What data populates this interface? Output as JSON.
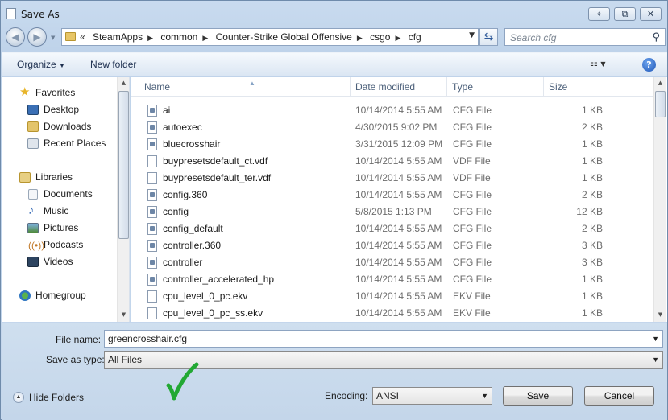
{
  "window": {
    "title": "Save As",
    "buttons": {
      "help": "⌖",
      "restore": "⧉",
      "close": "✕"
    }
  },
  "nav": {
    "back_icon": "back-arrow-icon",
    "forward_icon": "forward-arrow-icon",
    "breadcrumb_prefix": "«",
    "crumbs": [
      "SteamApps",
      "common",
      "Counter-Strike Global Offensive",
      "csgo",
      "cfg"
    ],
    "search_placeholder": "Search cfg"
  },
  "commandbar": {
    "organize": "Organize",
    "new_folder": "New folder",
    "help": "?"
  },
  "sidebar": {
    "items": [
      {
        "label": "Favorites",
        "icon": "star-icon",
        "color": "#e8b52a"
      },
      {
        "label": "Desktop",
        "icon": "desktop-icon",
        "color": "#3a6fb5"
      },
      {
        "label": "Downloads",
        "icon": "downloads-icon",
        "color": "#3b78c9"
      },
      {
        "label": "Recent Places",
        "icon": "recent-places-icon",
        "color": "#8a9aac"
      },
      {
        "label": "Libraries",
        "icon": "libraries-icon",
        "color": "#d9b75a"
      },
      {
        "label": "Documents",
        "icon": "documents-icon",
        "color": "#9aa8b8"
      },
      {
        "label": "Music",
        "icon": "music-icon",
        "color": "#3d6fb8"
      },
      {
        "label": "Pictures",
        "icon": "pictures-icon",
        "color": "#5a8fc6"
      },
      {
        "label": "Podcasts",
        "icon": "podcasts-icon",
        "color": "#c27a2a"
      },
      {
        "label": "Videos",
        "icon": "videos-icon",
        "color": "#2d4460"
      },
      {
        "label": "Homegroup",
        "icon": "homegroup-icon",
        "color": "#3c8d4a"
      }
    ]
  },
  "columns": {
    "name": "Name",
    "date": "Date modified",
    "type": "Type",
    "size": "Size"
  },
  "files": [
    {
      "name": "ai",
      "date": "10/14/2014 5:55 AM",
      "type": "CFG File",
      "size": "1 KB",
      "icon": "cfg"
    },
    {
      "name": "autoexec",
      "date": "4/30/2015 9:02 PM",
      "type": "CFG File",
      "size": "2 KB",
      "icon": "cfg"
    },
    {
      "name": "bluecrosshair",
      "date": "3/31/2015 12:09 PM",
      "type": "CFG File",
      "size": "1 KB",
      "icon": "cfg"
    },
    {
      "name": "buypresetsdefault_ct.vdf",
      "date": "10/14/2014 5:55 AM",
      "type": "VDF File",
      "size": "1 KB",
      "icon": "plain"
    },
    {
      "name": "buypresetsdefault_ter.vdf",
      "date": "10/14/2014 5:55 AM",
      "type": "VDF File",
      "size": "1 KB",
      "icon": "plain"
    },
    {
      "name": "config.360",
      "date": "10/14/2014 5:55 AM",
      "type": "CFG File",
      "size": "2 KB",
      "icon": "cfg"
    },
    {
      "name": "config",
      "date": "5/8/2015 1:13 PM",
      "type": "CFG File",
      "size": "12 KB",
      "icon": "cfg"
    },
    {
      "name": "config_default",
      "date": "10/14/2014 5:55 AM",
      "type": "CFG File",
      "size": "2 KB",
      "icon": "cfg"
    },
    {
      "name": "controller.360",
      "date": "10/14/2014 5:55 AM",
      "type": "CFG File",
      "size": "3 KB",
      "icon": "cfg"
    },
    {
      "name": "controller",
      "date": "10/14/2014 5:55 AM",
      "type": "CFG File",
      "size": "3 KB",
      "icon": "cfg"
    },
    {
      "name": "controller_accelerated_hp",
      "date": "10/14/2014 5:55 AM",
      "type": "CFG File",
      "size": "1 KB",
      "icon": "cfg"
    },
    {
      "name": "cpu_level_0_pc.ekv",
      "date": "10/14/2014 5:55 AM",
      "type": "EKV File",
      "size": "1 KB",
      "icon": "plain"
    },
    {
      "name": "cpu_level_0_pc_ss.ekv",
      "date": "10/14/2014 5:55 AM",
      "type": "EKV File",
      "size": "1 KB",
      "icon": "plain"
    }
  ],
  "bottom": {
    "file_name_label": "File name:",
    "file_name_value": "greencrosshair.cfg",
    "save_as_type_label": "Save as type:",
    "save_as_type_value": "All Files",
    "hide_folders": "Hide Folders",
    "encoding_label": "Encoding:",
    "encoding_value": "ANSI",
    "save": "Save",
    "cancel": "Cancel",
    "annotation_color": "#22a833"
  }
}
